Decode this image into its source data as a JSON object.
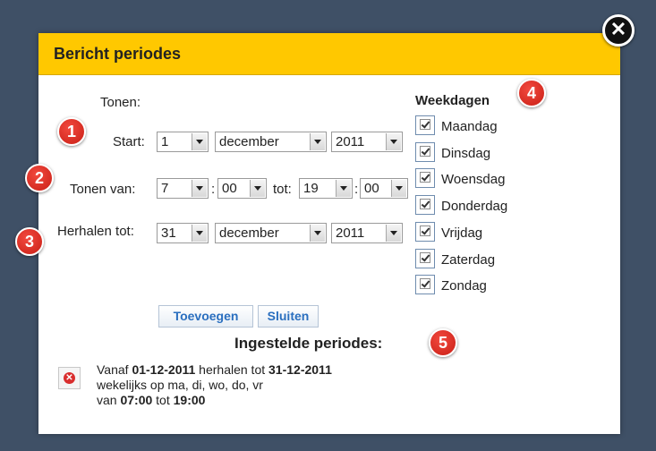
{
  "dialog": {
    "title": "Bericht periodes",
    "close_icon": "close-icon"
  },
  "form": {
    "tonen_label": "Tonen:",
    "start_label": "Start:",
    "start_day": "1",
    "start_month": "december",
    "start_year": "2011",
    "tonen_van_label": "Tonen van:",
    "from_hour": "7",
    "colon1": ":",
    "from_minute": "00",
    "tot_label": "tot:",
    "to_hour": "19",
    "colon2": ":",
    "to_minute": "00",
    "herhalen_label": "Herhalen tot:",
    "repeat_day": "31",
    "repeat_month": "december",
    "repeat_year": "2011"
  },
  "weekdays": {
    "heading": "Weekdagen",
    "items": [
      {
        "label": "Maandag",
        "checked": true
      },
      {
        "label": "Dinsdag",
        "checked": true
      },
      {
        "label": "Woensdag",
        "checked": true
      },
      {
        "label": "Donderdag",
        "checked": true
      },
      {
        "label": "Vrijdag",
        "checked": true
      },
      {
        "label": "Zaterdag",
        "checked": true
      },
      {
        "label": "Zondag",
        "checked": true
      }
    ]
  },
  "buttons": {
    "add": "Toevoegen",
    "close": "Sluiten"
  },
  "periods": {
    "heading": "Ingestelde periodes:",
    "items": [
      {
        "prefix": "Vanaf",
        "start": "01-12-2011",
        "mid": "herhalen tot",
        "end": "31-12-2011",
        "line2": "wekelijks op ma, di, wo, do, vr",
        "van": "van",
        "time_from": "07:00",
        "tot": "tot",
        "time_to": "19:00"
      }
    ]
  },
  "badges": [
    "1",
    "2",
    "3",
    "4",
    "5"
  ],
  "colors": {
    "header": "#ffc800",
    "background": "#3f5066",
    "badge": "#d9281e",
    "button_text": "#2a6fbf"
  }
}
